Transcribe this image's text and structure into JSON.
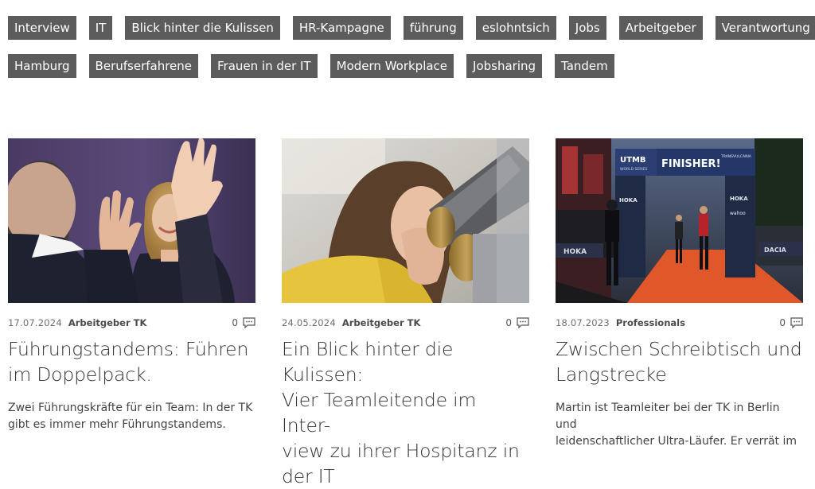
{
  "tags": {
    "row1": [
      "Interview",
      "IT",
      "Blick hinter die Kulissen",
      "HR-Kampagne",
      "führung",
      "eslohntsich",
      "Jobs",
      "Arbeitgeber",
      "Verantwortung"
    ],
    "row2": [
      "Hamburg",
      "Berufserfahrene",
      "Frauen in der IT",
      "Modern Workplace",
      "Jobsharing",
      "Tandem"
    ]
  },
  "cards": [
    {
      "date": "17.07.2024",
      "category": "Arbeitgeber TK",
      "comment_count": "0",
      "title_lines": [
        "Führungstandems: Führen",
        "im Doppelpack."
      ],
      "teaser_lines": [
        "Zwei Führungskräfte für ein Team: In der TK",
        "gibt es immer mehr Führungstandems."
      ]
    },
    {
      "date": "24.05.2024",
      "category": "Arbeitgeber TK",
      "comment_count": "0",
      "title_lines": [
        "Ein Blick hinter die Kulissen:",
        "Vier Teamleitende im Inter-",
        "view zu ihrer Hospitanz in",
        "der IT"
      ],
      "teaser_lines": []
    },
    {
      "date": "18.07.2023",
      "category": "Professionals",
      "comment_count": "0",
      "title_lines": [
        "Zwischen Schreibtisch und",
        "Langstrecke"
      ],
      "teaser_lines": [
        "Martin ist Teamleiter bei der TK in Berlin und",
        "leidenschaftlicher Ultra-Läufer. Er verrät im"
      ]
    }
  ],
  "image3": {
    "banner_left": "UTMB",
    "banner_left_sub": "WORLD SERIES",
    "banner_main": "FINISHER!",
    "banner_right": "TRANSVULCANIA",
    "pillar_left": "HOKA",
    "pillar_right": "HOKA",
    "pillar_right_2": "wahoo",
    "ground_left": "HOKA",
    "ground_right": "DACIA"
  },
  "colors": {
    "tag_bg": "#5c5c5c",
    "tag_text": "#ffffff",
    "track": "#e0572a"
  }
}
